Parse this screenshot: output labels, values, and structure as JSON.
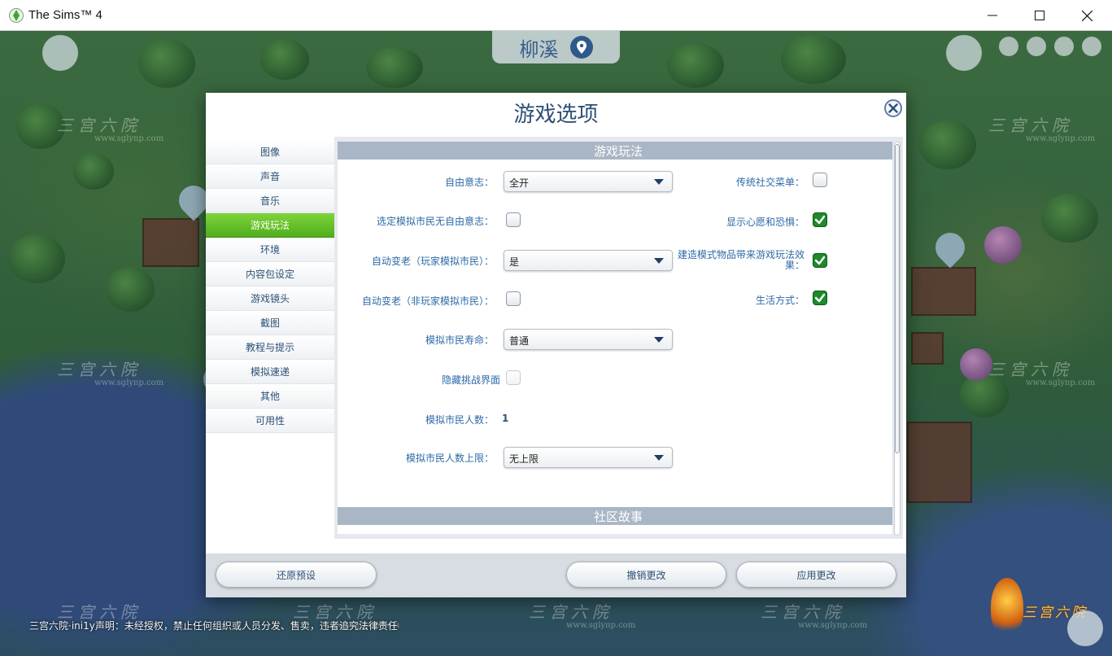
{
  "window": {
    "title": "The Sims™ 4",
    "controls": {
      "minimize_icon": "minimize-icon",
      "maximize_icon": "maximize-icon",
      "close_icon": "close-icon"
    }
  },
  "background": {
    "neighborhood_name": "柳溪",
    "watermark_text": "三宫六院",
    "watermark_url": "www.sglynp.com",
    "disclaimer": "三宫六院·ini1y声明：未经授权，禁止任何组织或人员分发、售卖，违者追究法律责任",
    "corner_logo_text": "三宫六院"
  },
  "dialog": {
    "title": "游戏选项",
    "nav": [
      {
        "label": "图像",
        "active": false
      },
      {
        "label": "声音",
        "active": false
      },
      {
        "label": "音乐",
        "active": false
      },
      {
        "label": "游戏玩法",
        "active": true
      },
      {
        "label": "环境",
        "active": false
      },
      {
        "label": "内容包设定",
        "active": false
      },
      {
        "label": "游戏镜头",
        "active": false
      },
      {
        "label": "截图",
        "active": false
      },
      {
        "label": "教程与提示",
        "active": false
      },
      {
        "label": "模拟速递",
        "active": false
      },
      {
        "label": "其他",
        "active": false
      },
      {
        "label": "可用性",
        "active": false
      }
    ],
    "section_gameplay": "游戏玩法",
    "section_community": "社区故事",
    "settings": {
      "free_will": {
        "label": "自由意志：",
        "value": "全开"
      },
      "selected_sim_no_free_will": {
        "label": "选定模拟市民无自由意志：",
        "checked": false
      },
      "auto_age_played": {
        "label": "自动变老（玩家模拟市民）：",
        "value": "是"
      },
      "auto_age_unplayed": {
        "label": "自动变老（非玩家模拟市民）：",
        "checked": false
      },
      "sim_lifespan": {
        "label": "模拟市民寿命：",
        "value": "普通"
      },
      "hide_challenge_ui": {
        "label": "隐藏挑战界面",
        "checked": false
      },
      "sim_count": {
        "label": "模拟市民人数：",
        "value": "1"
      },
      "sim_count_limit": {
        "label": "模拟市民人数上限：",
        "value": "无上限"
      },
      "legacy_social_menu": {
        "label": "传统社交菜单：",
        "checked": false
      },
      "show_wants_fears": {
        "label": "显示心愿和恐惧：",
        "checked": true
      },
      "build_mode_gameplay": {
        "label": "建造模式物品带来游戏玩法效果：",
        "checked": true
      },
      "lifestyles": {
        "label": "生活方式：",
        "checked": true
      }
    },
    "buttons": {
      "restore_defaults": "还原预设",
      "cancel_changes": "撤销更改",
      "apply_changes": "应用更改"
    }
  }
}
